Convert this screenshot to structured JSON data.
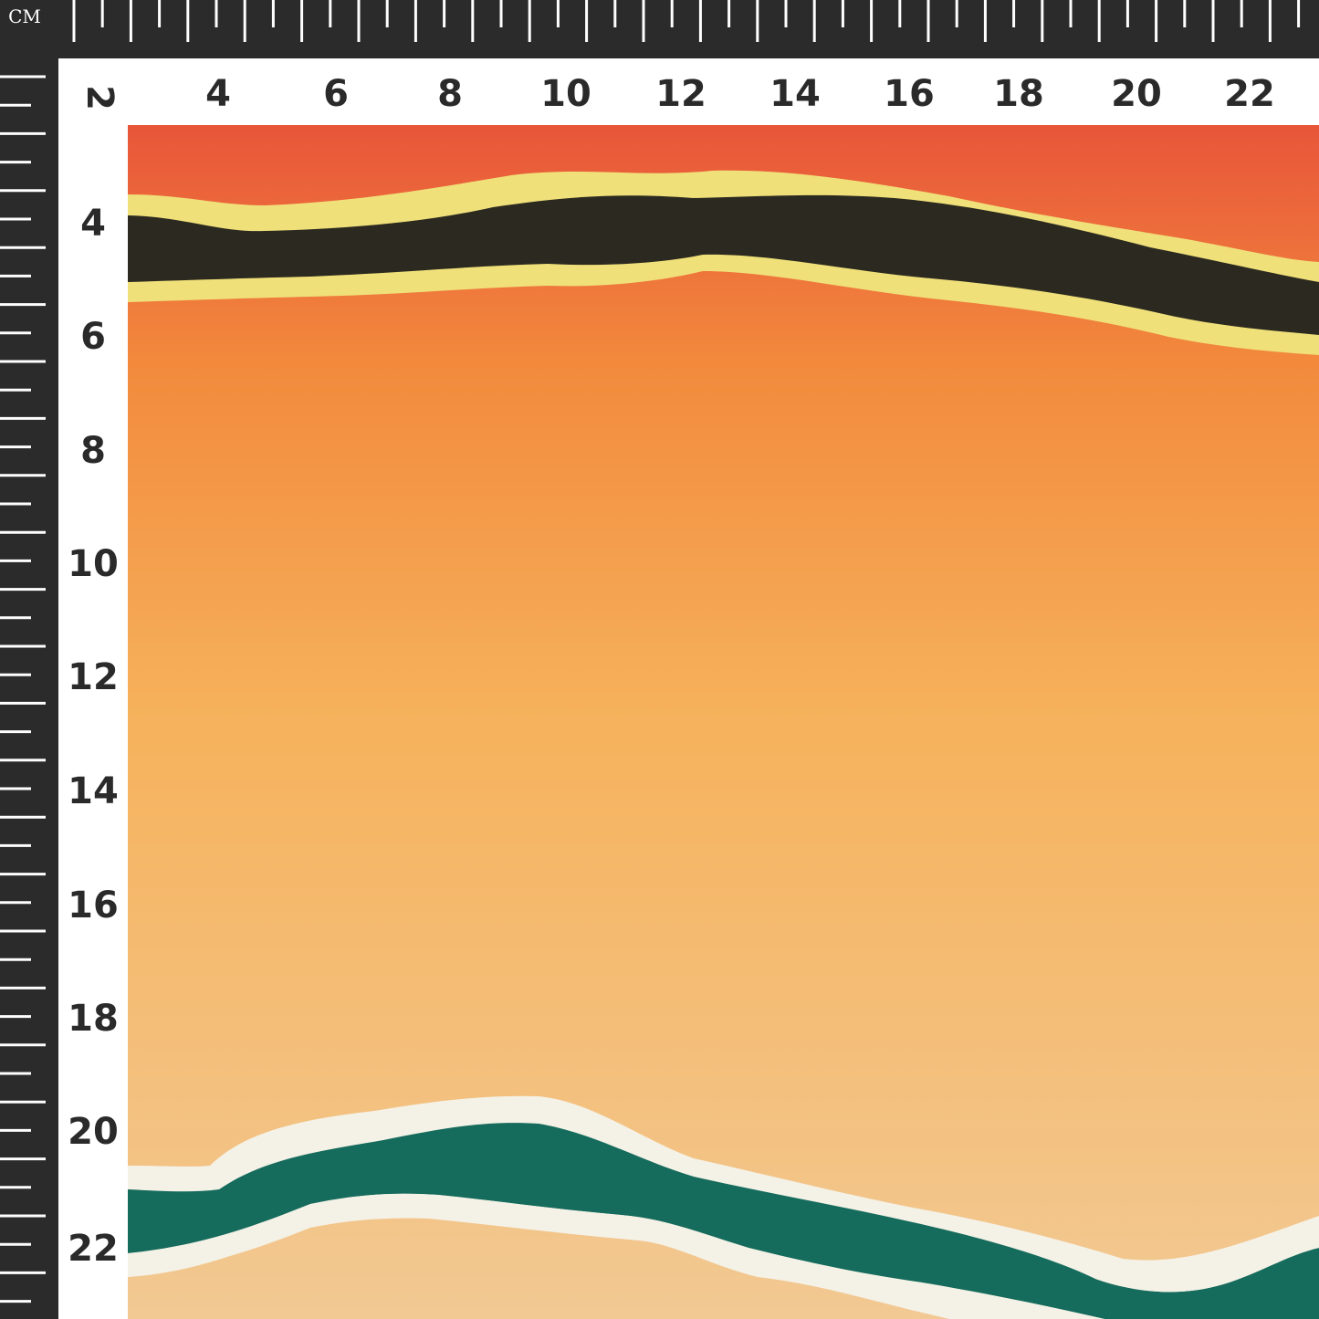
{
  "ruler": {
    "unit_label": "CM",
    "top_numbers": [
      "4",
      "6",
      "8",
      "10",
      "12",
      "14",
      "16",
      "18",
      "20",
      "22"
    ],
    "left_numbers": [
      "4",
      "6",
      "8",
      "10",
      "12",
      "14",
      "16",
      "18",
      "20",
      "22"
    ],
    "corner_number": "2"
  },
  "fabric": {
    "colors": {
      "top": "#e8553a",
      "upper": "#f28a3c",
      "middle": "#f6b25c",
      "bottom": "#f2c993",
      "dark_band": "#2c2a20",
      "yellow_edge": "#f0e07a",
      "teal_band": "#156b5c",
      "white_edge": "#f4f1e6"
    }
  }
}
